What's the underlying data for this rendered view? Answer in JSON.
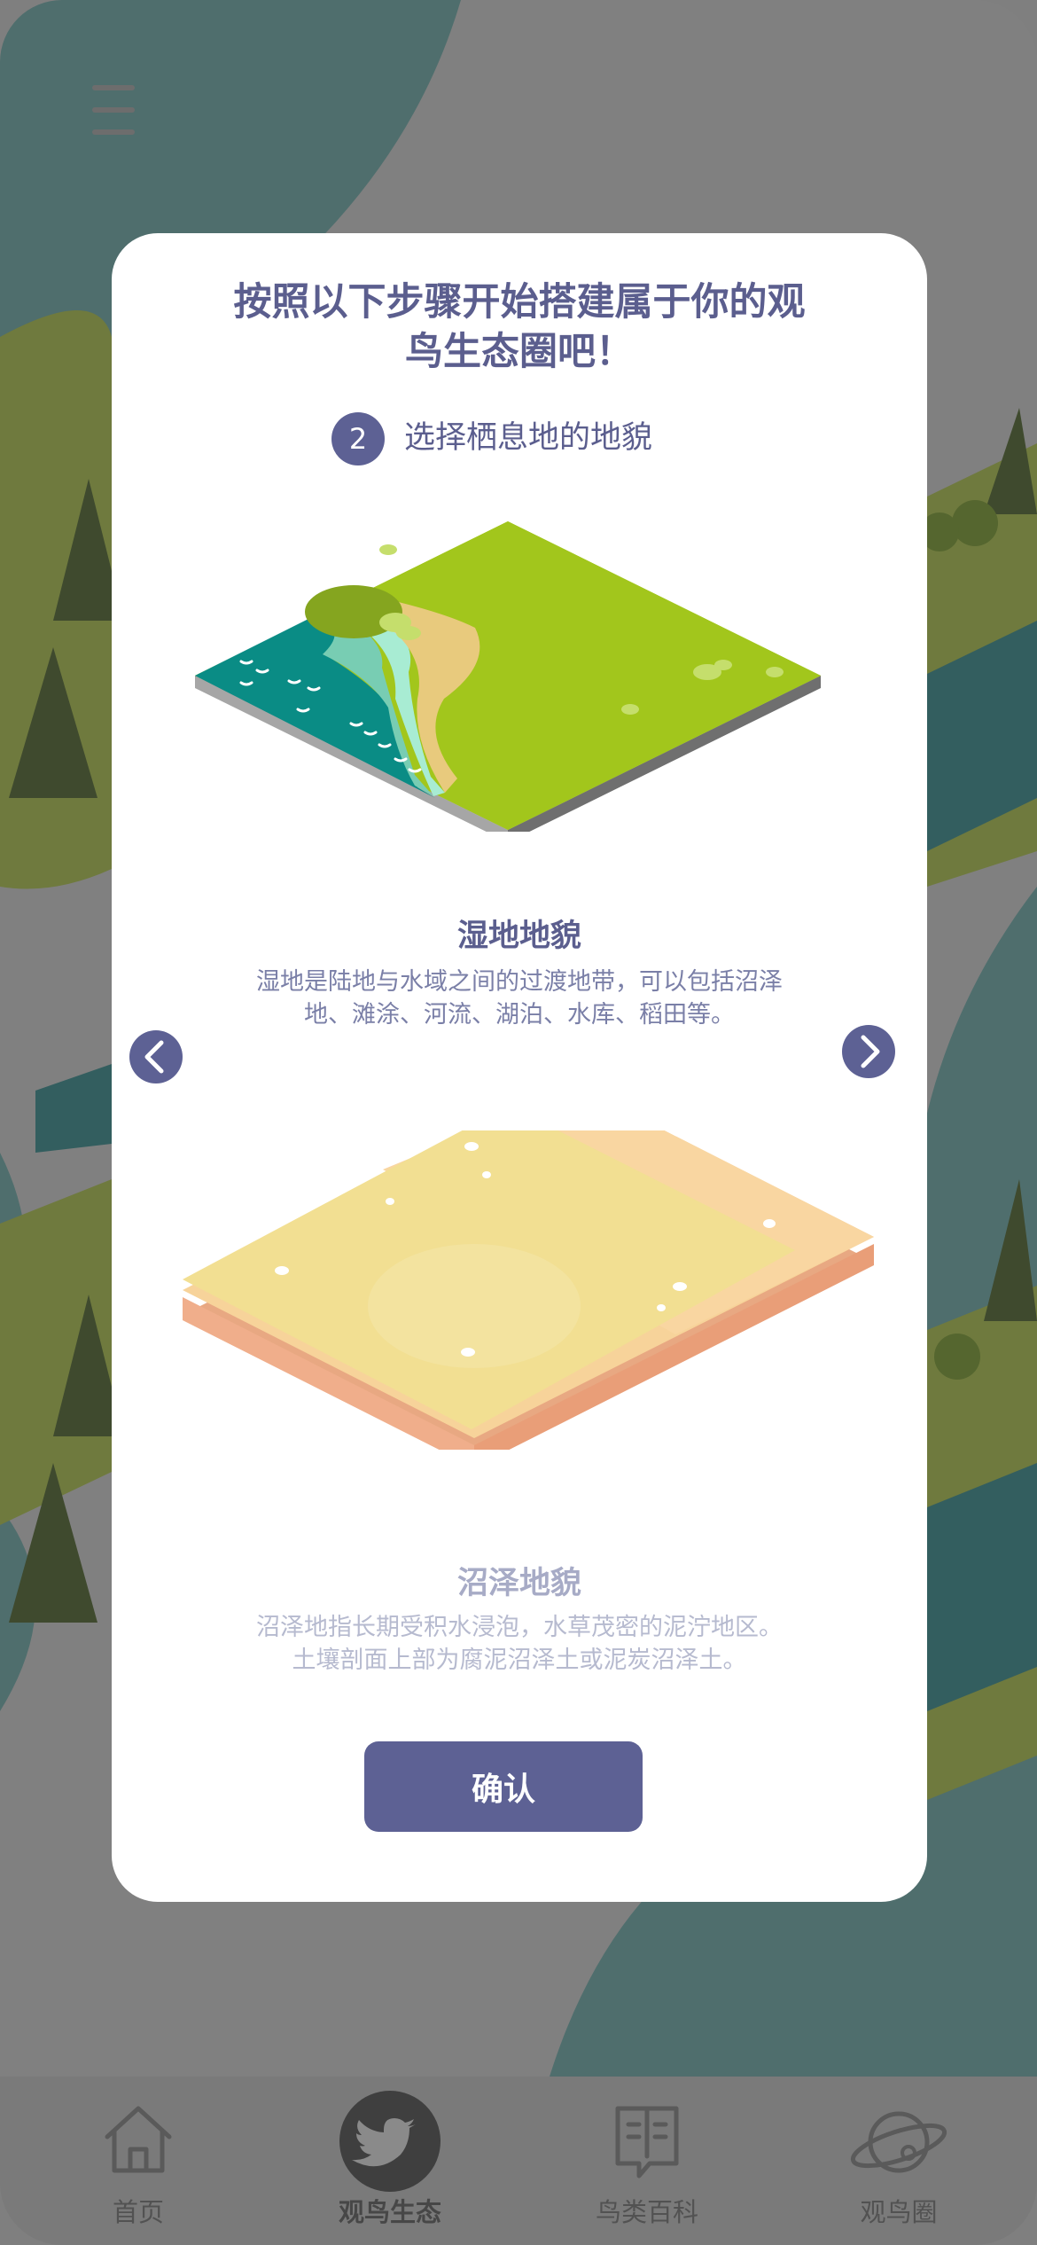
{
  "header": {
    "menu_icon": "hamburger-menu-icon"
  },
  "modal": {
    "title_line1": "按照以下步骤开始搭建属于你的观",
    "title_line2": "鸟生态圈吧！",
    "step": {
      "number": "2",
      "label": "选择栖息地的地貌"
    },
    "options": [
      {
        "name": "湿地地貌",
        "desc_line1": "湿地是陆地与水域之间的过渡地带，可以包括沼泽",
        "desc_line2": "地、滩涂、河流、湖泊、水库、稻田等。",
        "state": "selected"
      },
      {
        "name": "沼泽地貌",
        "desc_line1": "沼泽地指长期受积水浸泡，水草茂密的泥泞地区。",
        "desc_line2": "土壤剖面上部为腐泥沼泽土或泥炭沼泽土。",
        "state": "unselected"
      }
    ],
    "prev_icon": "chevron-left-icon",
    "next_icon": "chevron-right-icon",
    "confirm_label": "确认"
  },
  "tab_bar": {
    "items": [
      {
        "label": "首页",
        "icon": "home-icon"
      },
      {
        "label": "观鸟生态",
        "icon": "twitter-bird-icon",
        "active": true
      },
      {
        "label": "鸟类百科",
        "icon": "book-icon"
      },
      {
        "label": "观鸟圈",
        "icon": "planet-icon"
      }
    ]
  },
  "colors": {
    "accent": "#5d6194",
    "title": "#5b5e8e",
    "overlay": "#808080"
  }
}
